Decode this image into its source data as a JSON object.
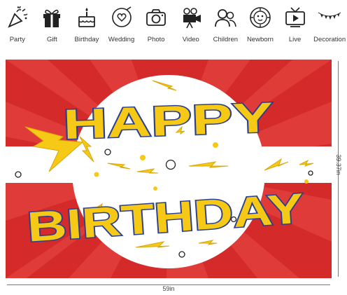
{
  "categories": [
    {
      "label": "Party",
      "icon": "party-popper-icon"
    },
    {
      "label": "Gift",
      "icon": "gift-icon"
    },
    {
      "label": "Birthday",
      "icon": "birthday-cake-icon"
    },
    {
      "label": "Wedding",
      "icon": "wedding-heart-icon"
    },
    {
      "label": "Photo",
      "icon": "camera-icon"
    },
    {
      "label": "Video",
      "icon": "video-camera-icon"
    },
    {
      "label": "Children",
      "icon": "children-icon"
    },
    {
      "label": "Newborn",
      "icon": "newborn-icon"
    },
    {
      "label": "Live",
      "icon": "tv-icon"
    },
    {
      "label": "Decoration",
      "icon": "bunting-icon"
    }
  ],
  "banner": {
    "line1": "HAPPY",
    "line2": "BIRTHDAY",
    "colors": {
      "red": "#d42a2a",
      "yellow": "#f5c916",
      "blue": "#2a3f8f",
      "white": "#ffffff"
    }
  },
  "dimensions": {
    "height": "39.37in",
    "width": "59in"
  }
}
